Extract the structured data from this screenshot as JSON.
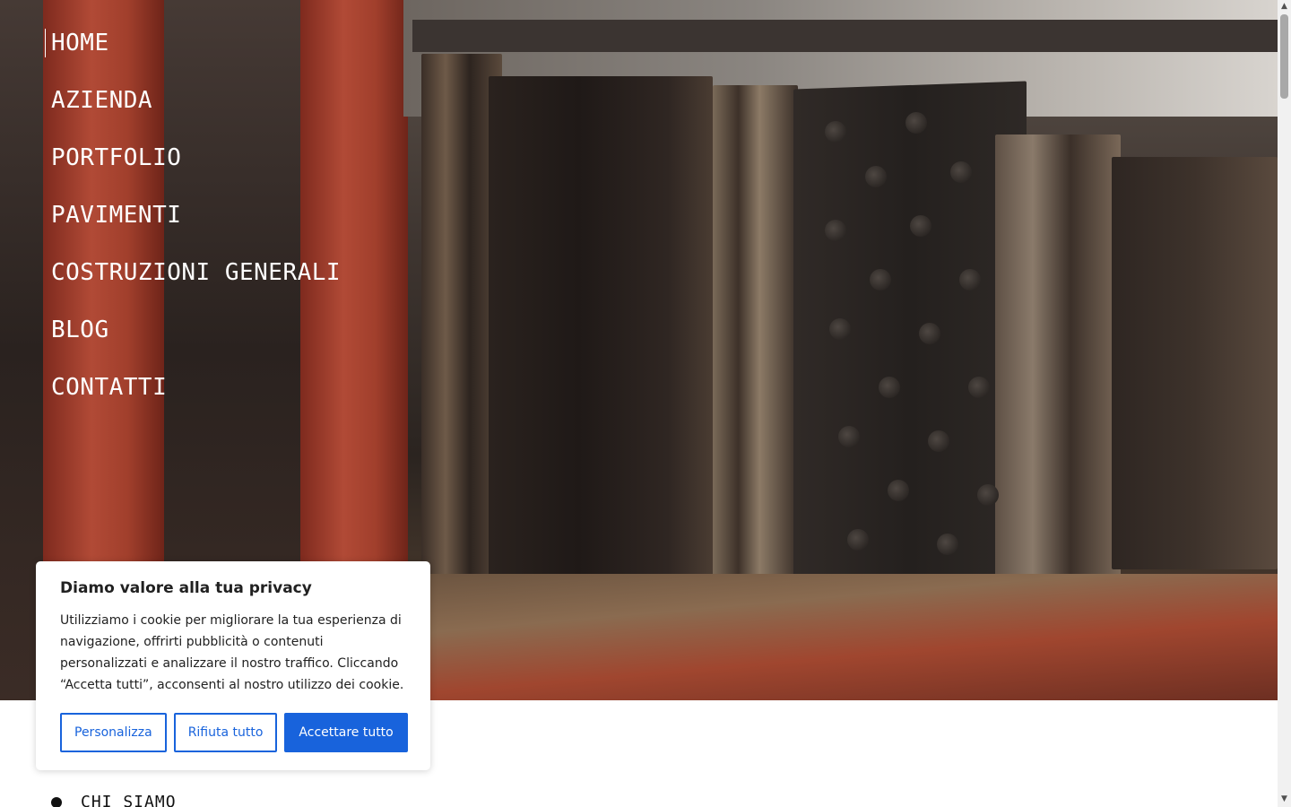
{
  "nav": {
    "items": [
      {
        "label": "HOME"
      },
      {
        "label": "AZIENDA"
      },
      {
        "label": "PORTFOLIO"
      },
      {
        "label": "PAVIMENTI"
      },
      {
        "label": "COSTRUZIONI GENERALI"
      },
      {
        "label": "BLOG"
      },
      {
        "label": "CONTATTI"
      }
    ]
  },
  "section": {
    "label": "CHI SIAMO"
  },
  "cookie": {
    "title": "Diamo valore alla tua privacy",
    "text": "Utilizziamo i cookie per migliorare la tua esperienza di navigazione, offrirti pubblicità o contenuti personalizzati e analizzare il nostro traffico. Cliccando “Accetta tutti”, acconsenti al nostro utilizzo dei cookie.",
    "customize_label": "Personalizza",
    "reject_label": "Rifiuta tutto",
    "accept_label": "Accettare tutto",
    "accent_color": "#1863dc"
  },
  "scrollbar": {
    "up_icon": "triangle-up-icon",
    "down_icon": "triangle-down-icon"
  }
}
